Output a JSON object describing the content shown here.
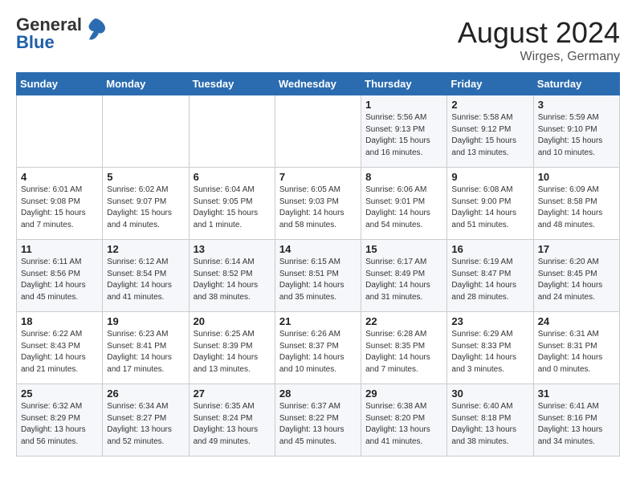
{
  "header": {
    "logo_general": "General",
    "logo_blue": "Blue",
    "month_year": "August 2024",
    "location": "Wirges, Germany"
  },
  "days_of_week": [
    "Sunday",
    "Monday",
    "Tuesday",
    "Wednesday",
    "Thursday",
    "Friday",
    "Saturday"
  ],
  "weeks": [
    [
      {
        "day": "",
        "info": ""
      },
      {
        "day": "",
        "info": ""
      },
      {
        "day": "",
        "info": ""
      },
      {
        "day": "",
        "info": ""
      },
      {
        "day": "1",
        "info": "Sunrise: 5:56 AM\nSunset: 9:13 PM\nDaylight: 15 hours\nand 16 minutes."
      },
      {
        "day": "2",
        "info": "Sunrise: 5:58 AM\nSunset: 9:12 PM\nDaylight: 15 hours\nand 13 minutes."
      },
      {
        "day": "3",
        "info": "Sunrise: 5:59 AM\nSunset: 9:10 PM\nDaylight: 15 hours\nand 10 minutes."
      }
    ],
    [
      {
        "day": "4",
        "info": "Sunrise: 6:01 AM\nSunset: 9:08 PM\nDaylight: 15 hours\nand 7 minutes."
      },
      {
        "day": "5",
        "info": "Sunrise: 6:02 AM\nSunset: 9:07 PM\nDaylight: 15 hours\nand 4 minutes."
      },
      {
        "day": "6",
        "info": "Sunrise: 6:04 AM\nSunset: 9:05 PM\nDaylight: 15 hours\nand 1 minute."
      },
      {
        "day": "7",
        "info": "Sunrise: 6:05 AM\nSunset: 9:03 PM\nDaylight: 14 hours\nand 58 minutes."
      },
      {
        "day": "8",
        "info": "Sunrise: 6:06 AM\nSunset: 9:01 PM\nDaylight: 14 hours\nand 54 minutes."
      },
      {
        "day": "9",
        "info": "Sunrise: 6:08 AM\nSunset: 9:00 PM\nDaylight: 14 hours\nand 51 minutes."
      },
      {
        "day": "10",
        "info": "Sunrise: 6:09 AM\nSunset: 8:58 PM\nDaylight: 14 hours\nand 48 minutes."
      }
    ],
    [
      {
        "day": "11",
        "info": "Sunrise: 6:11 AM\nSunset: 8:56 PM\nDaylight: 14 hours\nand 45 minutes."
      },
      {
        "day": "12",
        "info": "Sunrise: 6:12 AM\nSunset: 8:54 PM\nDaylight: 14 hours\nand 41 minutes."
      },
      {
        "day": "13",
        "info": "Sunrise: 6:14 AM\nSunset: 8:52 PM\nDaylight: 14 hours\nand 38 minutes."
      },
      {
        "day": "14",
        "info": "Sunrise: 6:15 AM\nSunset: 8:51 PM\nDaylight: 14 hours\nand 35 minutes."
      },
      {
        "day": "15",
        "info": "Sunrise: 6:17 AM\nSunset: 8:49 PM\nDaylight: 14 hours\nand 31 minutes."
      },
      {
        "day": "16",
        "info": "Sunrise: 6:19 AM\nSunset: 8:47 PM\nDaylight: 14 hours\nand 28 minutes."
      },
      {
        "day": "17",
        "info": "Sunrise: 6:20 AM\nSunset: 8:45 PM\nDaylight: 14 hours\nand 24 minutes."
      }
    ],
    [
      {
        "day": "18",
        "info": "Sunrise: 6:22 AM\nSunset: 8:43 PM\nDaylight: 14 hours\nand 21 minutes."
      },
      {
        "day": "19",
        "info": "Sunrise: 6:23 AM\nSunset: 8:41 PM\nDaylight: 14 hours\nand 17 minutes."
      },
      {
        "day": "20",
        "info": "Sunrise: 6:25 AM\nSunset: 8:39 PM\nDaylight: 14 hours\nand 13 minutes."
      },
      {
        "day": "21",
        "info": "Sunrise: 6:26 AM\nSunset: 8:37 PM\nDaylight: 14 hours\nand 10 minutes."
      },
      {
        "day": "22",
        "info": "Sunrise: 6:28 AM\nSunset: 8:35 PM\nDaylight: 14 hours\nand 7 minutes."
      },
      {
        "day": "23",
        "info": "Sunrise: 6:29 AM\nSunset: 8:33 PM\nDaylight: 14 hours\nand 3 minutes."
      },
      {
        "day": "24",
        "info": "Sunrise: 6:31 AM\nSunset: 8:31 PM\nDaylight: 14 hours\nand 0 minutes."
      }
    ],
    [
      {
        "day": "25",
        "info": "Sunrise: 6:32 AM\nSunset: 8:29 PM\nDaylight: 13 hours\nand 56 minutes."
      },
      {
        "day": "26",
        "info": "Sunrise: 6:34 AM\nSunset: 8:27 PM\nDaylight: 13 hours\nand 52 minutes."
      },
      {
        "day": "27",
        "info": "Sunrise: 6:35 AM\nSunset: 8:24 PM\nDaylight: 13 hours\nand 49 minutes."
      },
      {
        "day": "28",
        "info": "Sunrise: 6:37 AM\nSunset: 8:22 PM\nDaylight: 13 hours\nand 45 minutes."
      },
      {
        "day": "29",
        "info": "Sunrise: 6:38 AM\nSunset: 8:20 PM\nDaylight: 13 hours\nand 41 minutes."
      },
      {
        "day": "30",
        "info": "Sunrise: 6:40 AM\nSunset: 8:18 PM\nDaylight: 13 hours\nand 38 minutes."
      },
      {
        "day": "31",
        "info": "Sunrise: 6:41 AM\nSunset: 8:16 PM\nDaylight: 13 hours\nand 34 minutes."
      }
    ]
  ]
}
